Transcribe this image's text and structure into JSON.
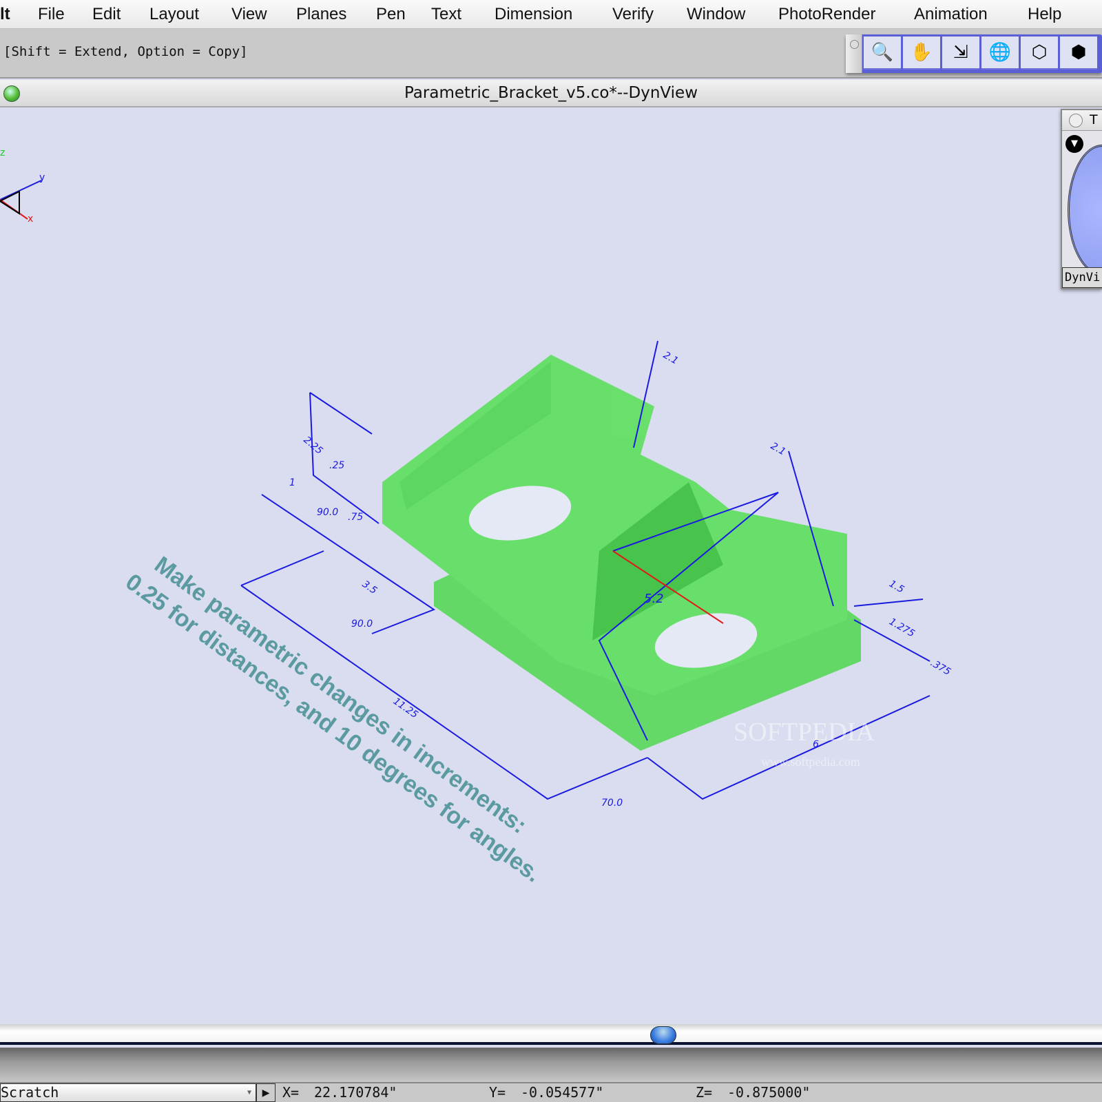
{
  "menubar": {
    "app": "lt",
    "items": [
      "File",
      "Edit",
      "Layout",
      "View",
      "Planes",
      "Pen",
      "Text",
      "Dimension",
      "Verify",
      "Window",
      "PhotoRender",
      "Animation",
      "Help"
    ]
  },
  "hint": "[Shift = Extend, Option = Copy]",
  "toolbar": {
    "buttons": [
      {
        "icon": "zoom-icon",
        "glyph": "🔍"
      },
      {
        "icon": "hand-pan-icon",
        "glyph": "✋"
      },
      {
        "icon": "move-arrow-icon",
        "glyph": "⇲"
      },
      {
        "icon": "orbit-globe-icon",
        "glyph": "🌐"
      },
      {
        "icon": "wireframe-cube-icon",
        "glyph": "⬡"
      },
      {
        "icon": "hidden-line-cube-icon",
        "glyph": "⬢"
      }
    ]
  },
  "window": {
    "title": "Parametric_Bracket_v5.co*--DynView"
  },
  "palette": {
    "title": "T",
    "label": "DynVi"
  },
  "axes": {
    "z": "z",
    "y": "y",
    "x": "x"
  },
  "dimensions": [
    "2.25",
    ".25",
    "1",
    "90.0",
    ".75",
    "3.5",
    "90.0",
    "11.25",
    "70.0",
    "6",
    "5.2",
    "1.5",
    "1.275",
    ".375",
    "2.1",
    "2.1"
  ],
  "annotation": {
    "line1": "Make parametric changes in increments:",
    "line2": "0.25 for distances, and 10 degrees for angles."
  },
  "watermark": {
    "text": "SOFTPEDIA",
    "url": "www.softpedia.com"
  },
  "colors": {
    "part": "#44e044",
    "dimension": "#1a1ae0",
    "annotation": "#5a9aa0",
    "background": "#d9ddef"
  },
  "status": {
    "layer": "Scratch",
    "x_label": "X=",
    "x": "22.170784\"",
    "y_label": "Y=",
    "y": "-0.054577\"",
    "z_label": "Z=",
    "z": "-0.875000\""
  }
}
